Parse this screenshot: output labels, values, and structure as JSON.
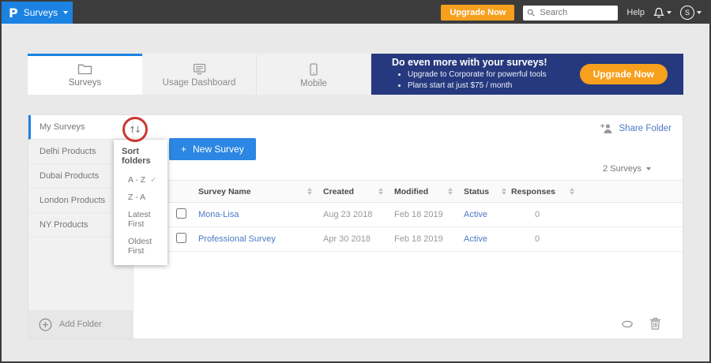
{
  "topbar": {
    "brand": {
      "logo": "P",
      "product": "Surveys"
    },
    "upgrade_label": "Upgrade Now",
    "search_placeholder": "Search",
    "help_label": "Help",
    "avatar_initial": "S"
  },
  "tabs": [
    {
      "label": "Surveys"
    },
    {
      "label": "Usage Dashboard"
    },
    {
      "label": "Mobile"
    }
  ],
  "banner": {
    "title": "Do even more with your surveys!",
    "bullets": [
      "Upgrade to Corporate for powerful tools",
      "Plans start at just $75 / month"
    ],
    "cta_label": "Upgrade Now"
  },
  "sidebar": {
    "folders": [
      {
        "label": "My Surveys"
      },
      {
        "label": "Delhi Products"
      },
      {
        "label": "Dubai Products"
      },
      {
        "label": "London Products"
      },
      {
        "label": "NY Products"
      }
    ],
    "add_folder_label": "Add Folder"
  },
  "sort_menu": {
    "title": "Sort folders",
    "options": [
      {
        "label": "A - Z"
      },
      {
        "label": "Z - A"
      },
      {
        "label": "Latest First"
      },
      {
        "label": "Oldest First"
      }
    ],
    "selected_option": "A - Z",
    "check_glyph": "✓"
  },
  "toolbar": {
    "new_survey_plus": "+",
    "new_survey_label": "New Survey",
    "share_folder_label": "Share Folder",
    "survey_count_label": "2 Surveys"
  },
  "table": {
    "headers": {
      "name": "Survey Name",
      "created": "Created",
      "modified": "Modified",
      "status": "Status",
      "responses": "Responses"
    },
    "rows": [
      {
        "name": "Mona-Lisa",
        "created": "Aug 23 2018",
        "modified": "Feb 18 2019",
        "status": "Active",
        "responses": "0"
      },
      {
        "name": "Professional Survey",
        "created": "Apr 30 2018",
        "modified": "Feb 18 2019",
        "status": "Active",
        "responses": "0"
      }
    ]
  },
  "colors": {
    "brand_blue": "#1b82e2",
    "accent_orange": "#f7a01d",
    "banner_navy": "#26397e",
    "link_blue": "#4d79c5",
    "annotation_red": "#cb3732"
  }
}
